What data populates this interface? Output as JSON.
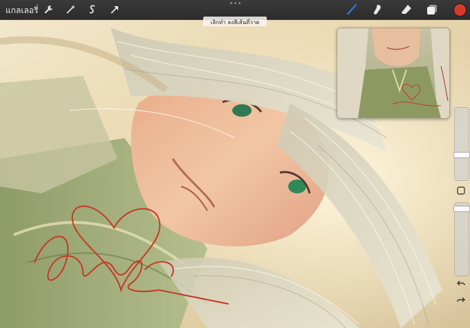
{
  "topbar": {
    "gallery_label": "แกลเลอรี่",
    "left_tools": [
      {
        "name": "wrench-icon"
      },
      {
        "name": "magic-wand-icon"
      },
      {
        "name": "selection-s-icon"
      },
      {
        "name": "transform-arrow-icon"
      }
    ],
    "right_tools": [
      {
        "name": "brush-icon"
      },
      {
        "name": "smudge-icon"
      },
      {
        "name": "eraser-icon"
      },
      {
        "name": "layers-icon"
      }
    ],
    "active_color": "#d83a2a",
    "accent_color": "#2b7bf0"
  },
  "toast": {
    "message": "เลิกทำ ลงสีเส้นที่วาด"
  },
  "sidebar": {
    "brush_size_level": 0.45,
    "opacity_level": 0.05,
    "undo_icon": "undo-icon",
    "redo_icon": "redo-icon",
    "modify_button_icon": "square-icon"
  },
  "canvas": {
    "artwork": "digital painting",
    "signature_color": "#c43a26"
  }
}
